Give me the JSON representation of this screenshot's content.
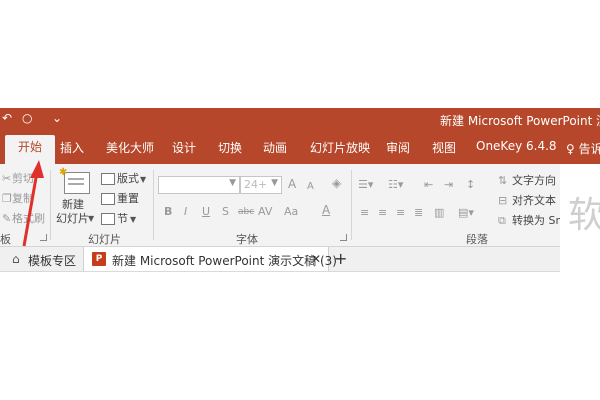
{
  "window": {
    "title": "新建 Microsoft PowerPoint 演示文",
    "qat_icons": [
      "undo-icon",
      "repeat-icon",
      "customize-icon"
    ]
  },
  "tabs": [
    {
      "label": "开始",
      "active": true
    },
    {
      "label": "插入"
    },
    {
      "label": "美化大师"
    },
    {
      "label": "设计"
    },
    {
      "label": "切换"
    },
    {
      "label": "动画"
    },
    {
      "label": "幻灯片放映"
    },
    {
      "label": "审阅"
    },
    {
      "label": "视图"
    },
    {
      "label": "OneKey 6.4.8"
    }
  ],
  "tell_me": "告诉",
  "clipboard": {
    "cut": "剪切",
    "copy": "复制",
    "format_painter": "格式刷",
    "label": "板"
  },
  "slides": {
    "new_slide_line1": "新建",
    "new_slide_line2": "幻灯片",
    "layout": "版式",
    "reset": "重置",
    "section": "节",
    "label": "幻灯片"
  },
  "font": {
    "font_name": "",
    "font_size": "24+",
    "grow": "A",
    "shrink": "A",
    "bold": "B",
    "italic": "I",
    "underline": "U",
    "shadow": "S",
    "strike": "abc",
    "spacing": "AV",
    "case": "Aa",
    "color": "A",
    "label": "字体"
  },
  "paragraph": {
    "text_direction": "文字方向",
    "align_text": "对齐文本",
    "convert_smartart": "转换为 Sm",
    "label": "段落"
  },
  "doc_tabs": [
    {
      "label": "模板专区",
      "icon": "home-icon"
    },
    {
      "label": "新建 Microsoft PowerPoint 演示文稿 (3)",
      "icon": "ppt-file-icon",
      "active": true,
      "badge": "P"
    }
  ],
  "doc_close": "✕",
  "doc_add": "+",
  "right_glyph": "软",
  "colors": {
    "accent": "#b7472a",
    "ribbon_bg": "#f3f3f3",
    "arrow": "#e0302a"
  }
}
